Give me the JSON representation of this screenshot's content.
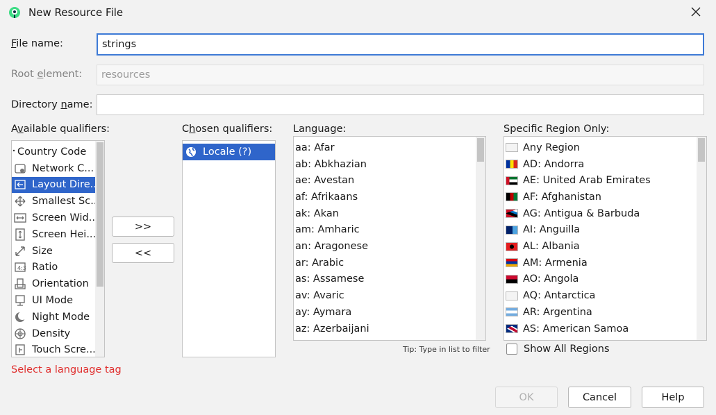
{
  "window": {
    "title": "New Resource File",
    "icon": "android-studio-icon"
  },
  "form": {
    "file_name_label_key": "F",
    "file_name_label_rest": "ile name:",
    "file_name_value": "strings",
    "root_element_label_pre": "Root ",
    "root_element_label_key": "e",
    "root_element_label_rest": "lement:",
    "root_element_placeholder": "resources",
    "directory_name_label_pre": "Directory ",
    "directory_name_label_key": "n",
    "directory_name_label_rest": "ame:",
    "directory_name_value": ""
  },
  "available": {
    "label_pre": "A",
    "label_key": "v",
    "label_rest": "ailable qualifiers:",
    "items": [
      {
        "label": "Country Code",
        "icon": "dot-icon"
      },
      {
        "label": "Network C...",
        "icon": "network-icon"
      },
      {
        "label": "Layout Dire...",
        "icon": "layout-direction-icon",
        "selected": true
      },
      {
        "label": "Smallest Sc...",
        "icon": "smallest-screen-icon"
      },
      {
        "label": "Screen Wid...",
        "icon": "screen-width-icon"
      },
      {
        "label": "Screen Hei...",
        "icon": "screen-height-icon"
      },
      {
        "label": "Size",
        "icon": "size-icon"
      },
      {
        "label": "Ratio",
        "icon": "ratio-icon"
      },
      {
        "label": "Orientation",
        "icon": "orientation-icon"
      },
      {
        "label": "UI Mode",
        "icon": "ui-mode-icon"
      },
      {
        "label": "Night Mode",
        "icon": "night-mode-icon"
      },
      {
        "label": "Density",
        "icon": "density-icon"
      },
      {
        "label": "Touch Scre...",
        "icon": "touch-screen-icon"
      }
    ]
  },
  "buttons": {
    "add": ">>",
    "remove": "<<",
    "ok": "OK",
    "cancel": "Cancel",
    "help": "Help"
  },
  "chosen": {
    "label_pre": "C",
    "label_key": "h",
    "label_rest": "osen qualifiers:",
    "items": [
      {
        "label": "Locale (?)",
        "icon": "globe-icon",
        "selected": true
      }
    ]
  },
  "language": {
    "label": "Language:",
    "items": [
      "aa: Afar",
      "ab: Abkhazian",
      "ae: Avestan",
      "af: Afrikaans",
      "ak: Akan",
      "am: Amharic",
      "an: Aragonese",
      "ar: Arabic",
      "as: Assamese",
      "av: Avaric",
      "ay: Aymara",
      "az: Azerbaijani"
    ],
    "tip": "Tip: Type in list to filter"
  },
  "region": {
    "label": "Specific Region Only:",
    "items": [
      {
        "label": "Any Region",
        "flag": "blank"
      },
      {
        "label": "AD: Andorra",
        "flag": "AD"
      },
      {
        "label": "AE: United Arab Emirates",
        "flag": "AE"
      },
      {
        "label": "AF: Afghanistan",
        "flag": "AF"
      },
      {
        "label": "AG: Antigua & Barbuda",
        "flag": "AG"
      },
      {
        "label": "AI: Anguilla",
        "flag": "AI"
      },
      {
        "label": "AL: Albania",
        "flag": "AL"
      },
      {
        "label": "AM: Armenia",
        "flag": "AM"
      },
      {
        "label": "AO: Angola",
        "flag": "AO"
      },
      {
        "label": "AQ: Antarctica",
        "flag": "blank"
      },
      {
        "label": "AR: Argentina",
        "flag": "AR"
      },
      {
        "label": "AS: American Samoa",
        "flag": "AS"
      }
    ],
    "show_all_label": "Show All Regions",
    "show_all_checked": false
  },
  "status": {
    "error": "Select a language tag"
  },
  "colors": {
    "selection": "#2f65ca",
    "focus_border": "#3d7ad6",
    "error": "#e0302f"
  }
}
